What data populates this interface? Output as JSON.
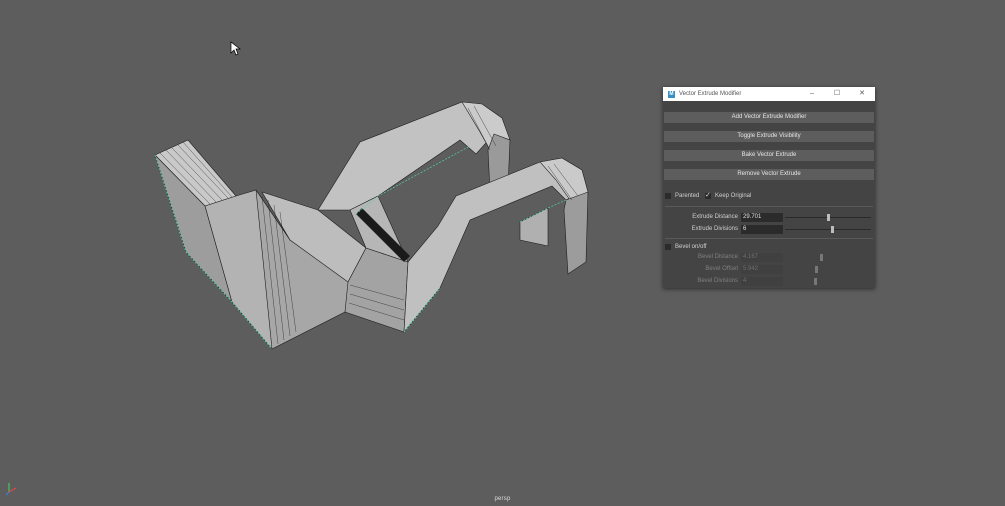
{
  "viewport": {
    "view_label": "persp"
  },
  "window": {
    "app_icon": "M",
    "title": "Vector Extrude Modifier",
    "minimize": "–",
    "maximize": "☐",
    "close": "✕"
  },
  "buttons": {
    "add": "Add Vector Extrude Modifier",
    "toggle": "Toggle Extrude Visibility",
    "bake": "Bake Vector Extrude",
    "remove": "Remove Vector Extrude"
  },
  "options": {
    "parented": {
      "label": "Parented",
      "checked": false
    },
    "keep_original": {
      "label": "Keep Original",
      "checked": true
    }
  },
  "extrude": {
    "distance": {
      "label": "Extrude Distance",
      "value": "29.701",
      "slider_fraction": 0.5
    },
    "divisions": {
      "label": "Extrude Divisions",
      "value": "6",
      "slider_fraction": 0.56
    }
  },
  "bevel": {
    "toggle": {
      "label": "Bevel on/off",
      "checked": false
    },
    "distance": {
      "label": "Bevel Distance",
      "value": "4.167",
      "slider_fraction": 0.42
    },
    "offset": {
      "label": "Bevel Offset",
      "value": "5.942",
      "slider_fraction": 0.36
    },
    "divisions": {
      "label": "Bevel Divisions",
      "value": "4",
      "slider_fraction": 0.35
    }
  },
  "colors": {
    "viewport_bg": "#5d5d5d",
    "panel_bg": "#444444",
    "mesh_face": "#b8b8b8",
    "selection_edge": "#4fd3b0"
  }
}
